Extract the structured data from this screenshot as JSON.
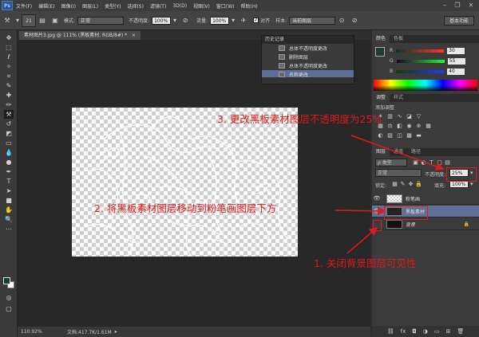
{
  "app": {
    "logo": "Ps"
  },
  "menu": [
    "文件(F)",
    "编辑(E)",
    "图像(I)",
    "图层(L)",
    "类型(Y)",
    "选择(S)",
    "滤镜(T)",
    "3D(D)",
    "视图(V)",
    "窗口(W)",
    "帮助(H)"
  ],
  "window_controls": [
    "minimize-icon",
    "restore-icon",
    "close-icon"
  ],
  "options_bar": {
    "brush_size": "21",
    "mode_label": "模式:",
    "mode_value": "正常",
    "opacity_label": "不透明度:",
    "opacity_value": "100%",
    "flow_label": "流量:",
    "flow_value": "100%",
    "align_checked": "✓",
    "align_label": "对齐",
    "sample_label": "样本:",
    "sample_value": "当前图层",
    "workspace_button": "基本功能"
  },
  "document": {
    "tab_title": "素材图片3.jpg @ 111% (黑板素材, RGB/8#) *",
    "close_glyph": "×"
  },
  "status": {
    "zoom": "110.92%",
    "doc_size": "文档:417.7K/1.61M"
  },
  "history_panel": {
    "title": "历史记录",
    "items": [
      "总体不透明度更改",
      "删除图层",
      "总体不透明度更改",
      "名称更改"
    ],
    "selected_index": 3
  },
  "color_panel": {
    "tabs": [
      "颜色",
      "色板"
    ],
    "foreground": "#1d3c34",
    "channels": [
      {
        "label": "R",
        "value": "30"
      },
      {
        "label": "G",
        "value": "55"
      },
      {
        "label": "B",
        "value": "40"
      }
    ]
  },
  "adjust_panel": {
    "tabs": [
      "调整",
      "样式"
    ],
    "heading": "添加调整"
  },
  "layers_panel": {
    "tabs": [
      "图层",
      "通道",
      "路径"
    ],
    "filter_value": "ρ 类型",
    "blend_mode": "正常",
    "opacity_label": "不透明度:",
    "opacity_value": "25%",
    "lock_label": "锁定:",
    "fill_label": "填充:",
    "fill_value": "100%",
    "layers": [
      {
        "name": "粉笔画",
        "visible_glyph": "👁",
        "selected": false
      },
      {
        "name": "黑板素材",
        "visible_glyph": "👁",
        "selected": true
      },
      {
        "name": "背景",
        "visible_glyph": "",
        "selected": false,
        "lock_glyph": "🔒"
      }
    ]
  },
  "annotations": {
    "step1": "1. 关闭背景图层可见性",
    "step2": "2. 将黑板素材图层移动到粉笔画图层下方",
    "step3": "3. 更改黑板素材图层不透明度为25%",
    "color": "#e0191b"
  }
}
